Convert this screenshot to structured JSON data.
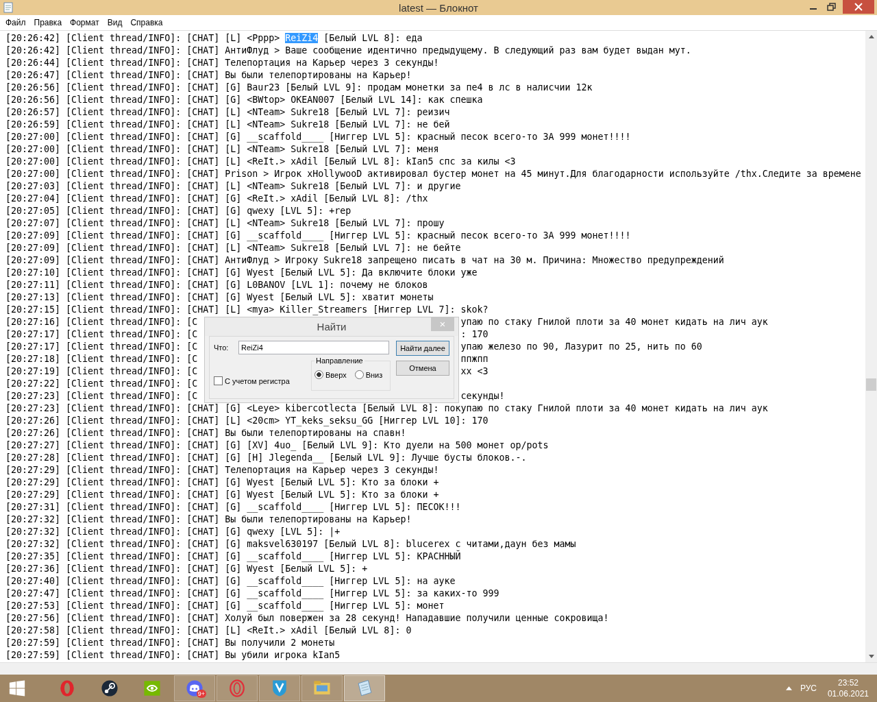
{
  "window": {
    "title": "latest — Блокнот"
  },
  "menu": [
    "Файл",
    "Правка",
    "Формат",
    "Вид",
    "Справка"
  ],
  "lines": [
    {
      "kind": "selection",
      "text": "[20:26:42] [Client thread/INFO]: [CHAT] [L] <Pppp> ",
      "selection": "ReiZi4",
      "after": " [Белый LVL 8]: еда"
    },
    {
      "kind": "plain",
      "text": "[20:26:42] [Client thread/INFO]: [CHAT] АнтиФлуд > Ваше сообщение идентично предыдущему. В следующий раз вам будет выдан мут."
    },
    {
      "kind": "plain",
      "text": "[20:26:44] [Client thread/INFO]: [CHAT] Телепортация на Карьер через 3 секунды!"
    },
    {
      "kind": "plain",
      "text": "[20:26:47] [Client thread/INFO]: [CHAT] Вы были телепортированы на Карьер!"
    },
    {
      "kind": "plain",
      "text": "[20:26:56] [Client thread/INFO]: [CHAT] [G] Baur23 [Белый LVL 9]: продам монетки за пе4 в лс в налисчии 12к"
    },
    {
      "kind": "plain",
      "text": "[20:26:56] [Client thread/INFO]: [CHAT] [G] <BWtop> OKEAN007 [Белый LVL 14]: как спешка"
    },
    {
      "kind": "plain",
      "text": "[20:26:57] [Client thread/INFO]: [CHAT] [L] <NTeam> Sukre18 [Белый LVL 7]: реизич"
    },
    {
      "kind": "plain",
      "text": "[20:26:59] [Client thread/INFO]: [CHAT] [L] <NTeam> Sukre18 [Белый LVL 7]: не бей"
    },
    {
      "kind": "plain",
      "text": "[20:27:00] [Client thread/INFO]: [CHAT] [G] __scaffold____ [Ниггер LVL 5]: красный песок всего-то ЗА 999 монет!!!!"
    },
    {
      "kind": "plain",
      "text": "[20:27:00] [Client thread/INFO]: [CHAT] [L] <NTeam> Sukre18 [Белый LVL 7]: меня"
    },
    {
      "kind": "plain",
      "text": "[20:27:00] [Client thread/INFO]: [CHAT] [L] <ReIt.> xAdil [Белый LVL 8]: kIan5 спс за килы <3"
    },
    {
      "kind": "plain",
      "text": "[20:27:00] [Client thread/INFO]: [CHAT] Prison > Игрок xHollywooD активировал бустер монет на 45 минут.Для благодарности используйте /thx.Следите за времене"
    },
    {
      "kind": "plain",
      "text": "[20:27:03] [Client thread/INFO]: [CHAT] [L] <NTeam> Sukre18 [Белый LVL 7]: и другие"
    },
    {
      "kind": "plain",
      "text": "[20:27:04] [Client thread/INFO]: [CHAT] [G] <ReIt.> xAdil [Белый LVL 8]: /thx"
    },
    {
      "kind": "plain",
      "text": "[20:27:05] [Client thread/INFO]: [CHAT] [G] qwexy [LVL 5]: +rep"
    },
    {
      "kind": "plain",
      "text": "[20:27:07] [Client thread/INFO]: [CHAT] [L] <NTeam> Sukre18 [Белый LVL 7]: прошу"
    },
    {
      "kind": "plain",
      "text": "[20:27:09] [Client thread/INFO]: [CHAT] [G] __scaffold____ [Ниггер LVL 5]: красный песок всего-то ЗА 999 монет!!!!"
    },
    {
      "kind": "plain",
      "text": "[20:27:09] [Client thread/INFO]: [CHAT] [L] <NTeam> Sukre18 [Белый LVL 7]: не бейте"
    },
    {
      "kind": "plain",
      "text": "[20:27:09] [Client thread/INFO]: [CHAT] АнтиФлуд > Игроку Sukre18 запрещено писать в чат на 30 м. Причина: Множество предупреждений"
    },
    {
      "kind": "plain",
      "text": "[20:27:10] [Client thread/INFO]: [CHAT] [G] Wyest [Белый LVL 5]: Да включите блоки уже"
    },
    {
      "kind": "plain",
      "text": "[20:27:11] [Client thread/INFO]: [CHAT] [G] L0BANOV [LVL 1]: почему не блоков"
    },
    {
      "kind": "plain",
      "text": "[20:27:13] [Client thread/INFO]: [CHAT] [G] Wyest [Белый LVL 5]: хватит монеты"
    },
    {
      "kind": "plain",
      "text": "[20:27:15] [Client thread/INFO]: [CHAT] [L] <mya> Killer_Streamers [Ниггер LVL 7]: skok?"
    },
    {
      "kind": "covered",
      "text": "[20:27:16] [Client thread/INFO]: [C",
      "tail": "упаю по стаку Гнилой плоти за 40 монет кидать на лич аук"
    },
    {
      "kind": "covered",
      "text": "[20:27:17] [Client thread/INFO]: [C",
      "tail": ": 170"
    },
    {
      "kind": "covered",
      "text": "[20:27:17] [Client thread/INFO]: [C",
      "tail": "упаю железо по 90, Лазурит по 25, нить по 60"
    },
    {
      "kind": "covered",
      "text": "[20:27:18] [Client thread/INFO]: [C",
      "tail": "ппжпп"
    },
    {
      "kind": "covered",
      "text": "[20:27:19] [Client thread/INFO]: [C",
      "tail": "xx <3"
    },
    {
      "kind": "covered",
      "text": "[20:27:22] [Client thread/INFO]: [C"
    },
    {
      "kind": "covered",
      "text": "[20:27:23] [Client thread/INFO]: [C",
      "tail": "секунды!"
    },
    {
      "kind": "plain",
      "text": "[20:27:23] [Client thread/INFO]: [CHAT] [G] <Leye> kibercotlecta [Белый LVL 8]: покупаю по стаку Гнилой плоти за 40 монет кидать на лич аук"
    },
    {
      "kind": "plain",
      "text": "[20:27:26] [Client thread/INFO]: [CHAT] [L] <20cm> YT_keks_seksu_GG [Ниггер LVL 10]: 170"
    },
    {
      "kind": "plain",
      "text": "[20:27:26] [Client thread/INFO]: [CHAT] Вы были телепортированы на спавн!"
    },
    {
      "kind": "plain",
      "text": "[20:27:27] [Client thread/INFO]: [CHAT] [G] [XV] 4uo_ [Белый LVL 9]: Кто дуели на 500 монет op/pots"
    },
    {
      "kind": "plain",
      "text": "[20:27:28] [Client thread/INFO]: [CHAT] [G] [H] Jlegenda__ [Белый LVL 9]: Лучше бусты блоков.-."
    },
    {
      "kind": "plain",
      "text": "[20:27:29] [Client thread/INFO]: [CHAT] Телепортация на Карьер через 3 секунды!"
    },
    {
      "kind": "plain",
      "text": "[20:27:29] [Client thread/INFO]: [CHAT] [G] Wyest [Белый LVL 5]: Кто за блоки +"
    },
    {
      "kind": "plain",
      "text": "[20:27:29] [Client thread/INFO]: [CHAT] [G] Wyest [Белый LVL 5]: Кто за блоки +"
    },
    {
      "kind": "plain",
      "text": "[20:27:31] [Client thread/INFO]: [CHAT] [G] __scaffold____ [Ниггер LVL 5]: ПЕСОК!!!"
    },
    {
      "kind": "plain",
      "text": "[20:27:32] [Client thread/INFO]: [CHAT] Вы были телепортированы на Карьер!"
    },
    {
      "kind": "plain",
      "text": "[20:27:32] [Client thread/INFO]: [CHAT] [G] qwexy [LVL 5]: |+"
    },
    {
      "kind": "plain",
      "text": "[20:27:32] [Client thread/INFO]: [CHAT] [G] maksvel630197 [Белый LVL 8]: blucerex с читами,даун без мамы"
    },
    {
      "kind": "plain",
      "text": "[20:27:35] [Client thread/INFO]: [CHAT] [G] __scaffold____ [Ниггер LVL 5]: КРАСННЫЙ"
    },
    {
      "kind": "plain",
      "text": "[20:27:36] [Client thread/INFO]: [CHAT] [G] Wyest [Белый LVL 5]: +"
    },
    {
      "kind": "plain",
      "text": "[20:27:40] [Client thread/INFO]: [CHAT] [G] __scaffold____ [Ниггер LVL 5]: на ауке"
    },
    {
      "kind": "plain",
      "text": "[20:27:47] [Client thread/INFO]: [CHAT] [G] __scaffold____ [Ниггер LVL 5]: за каких-то 999"
    },
    {
      "kind": "plain",
      "text": "[20:27:53] [Client thread/INFO]: [CHAT] [G] __scaffold____ [Ниггер LVL 5]: монет"
    },
    {
      "kind": "plain",
      "text": "[20:27:56] [Client thread/INFO]: [CHAT] Холуй был повержен за 28 секунд! Нападавшие получили ценные сокровища!"
    },
    {
      "kind": "plain",
      "text": "[20:27:58] [Client thread/INFO]: [CHAT] [L] <ReIt.> xAdil [Белый LVL 8]: 0"
    },
    {
      "kind": "plain",
      "text": "[20:27:59] [Client thread/INFO]: [CHAT] Вы получили 2 монеты"
    },
    {
      "kind": "plain",
      "text": "[20:27:59] [Client thread/INFO]: [CHAT] Вы убили игрока kIan5"
    }
  ],
  "find_dialog": {
    "title": "Найти",
    "close": "×",
    "label": "Что:",
    "value": "ReiZi4",
    "find_button": "Найти далее",
    "cancel_button": "Отмена",
    "direction": {
      "title": "Направление",
      "options": [
        {
          "label": "Вверх",
          "selected": true
        },
        {
          "label": "Вниз",
          "selected": false
        }
      ]
    },
    "match_case": {
      "label": "С учетом регистра",
      "checked": false
    }
  },
  "taskbar": {
    "apps": [
      {
        "kind": "opera",
        "running": false
      },
      {
        "kind": "steam",
        "running": false
      },
      {
        "kind": "nvidia",
        "running": false
      },
      {
        "kind": "discord",
        "running": true,
        "badge": "9+"
      },
      {
        "kind": "operagx",
        "running": true
      },
      {
        "kind": "shield",
        "running": true
      },
      {
        "kind": "explorer",
        "running": true
      },
      {
        "kind": "notepad",
        "running": true,
        "active": true
      }
    ],
    "language": "РУС",
    "time": "23:52",
    "date": "01.06.2021"
  }
}
